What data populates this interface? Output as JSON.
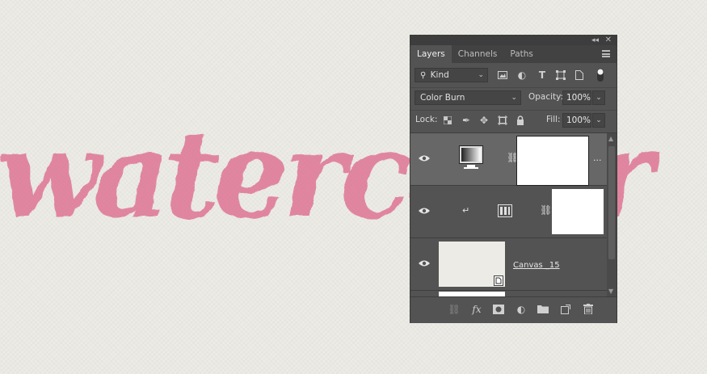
{
  "artwork": {
    "text": "watercolor",
    "color": "#dc5f86"
  },
  "panel": {
    "tabs": [
      {
        "label": "Layers",
        "active": true
      },
      {
        "label": "Channels",
        "active": false
      },
      {
        "label": "Paths",
        "active": false
      }
    ],
    "filter": {
      "kind_label": "Kind"
    },
    "blend": {
      "mode": "Color Burn",
      "opacity_label": "Opacity:",
      "opacity": "100%"
    },
    "lock": {
      "label": "Lock:",
      "fill_label": "Fill:",
      "fill": "100%"
    },
    "layers": [
      {
        "type": "gradient-map-adjustment",
        "selected": true,
        "visible": true,
        "name": "",
        "more": "..."
      },
      {
        "type": "levels-adjustment",
        "clipped": true,
        "selected": false,
        "visible": true,
        "name": ""
      },
      {
        "type": "smart-object",
        "selected": false,
        "visible": true,
        "name": "Canvas _15"
      }
    ]
  },
  "colors": {
    "panel": "#535353",
    "selected_layer": "#676767",
    "background": "#ecebe6"
  }
}
